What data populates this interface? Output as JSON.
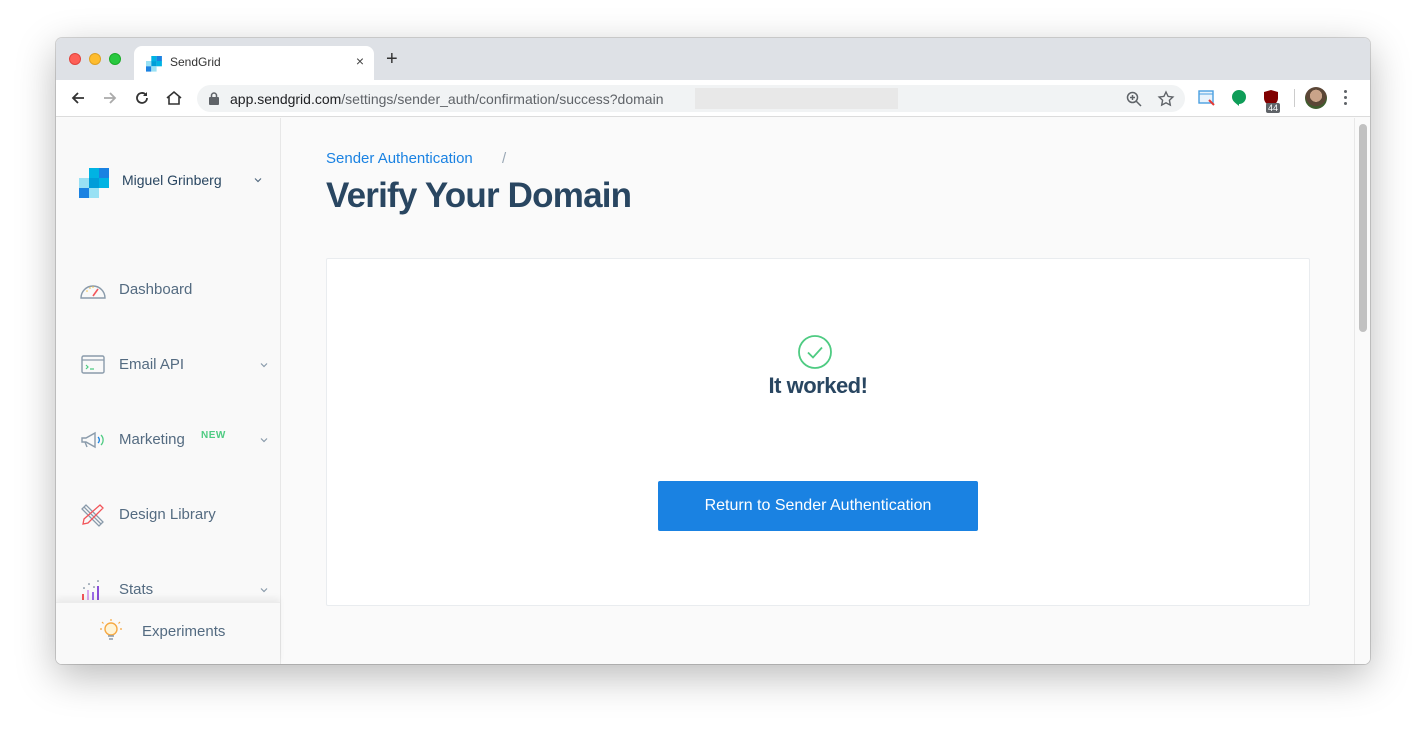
{
  "browser": {
    "tab": {
      "title": "SendGrid",
      "close_glyph": "×"
    },
    "new_tab_glyph": "+",
    "url": {
      "host": "app.sendgrid.com",
      "path": "/settings/sender_auth/confirmation/success?domain"
    },
    "extension_badge": "44"
  },
  "sidebar": {
    "account_name": "Miguel Grinberg",
    "items": [
      {
        "label": "Dashboard",
        "icon": "dashboard-gauge-icon",
        "has_chevron": false
      },
      {
        "label": "Email API",
        "icon": "terminal-window-icon",
        "has_chevron": true
      },
      {
        "label": "Marketing",
        "icon": "megaphone-icon",
        "has_chevron": true,
        "badge": "NEW"
      },
      {
        "label": "Design Library",
        "icon": "pencil-ruler-icon",
        "has_chevron": false
      },
      {
        "label": "Stats",
        "icon": "bar-stats-icon",
        "has_chevron": true
      }
    ],
    "footer": {
      "label": "Experiments",
      "icon": "lightbulb-icon"
    }
  },
  "main": {
    "breadcrumb": {
      "parent": "Sender Authentication",
      "separator": "/"
    },
    "title": "Verify Your Domain",
    "card": {
      "message": "It worked!",
      "button_label": "Return to Sender Authentication"
    }
  },
  "colors": {
    "brand_blue": "#1a82e2",
    "heading_navy": "#294661",
    "success_green": "#4ecb82",
    "new_badge": "#4ecb82"
  }
}
